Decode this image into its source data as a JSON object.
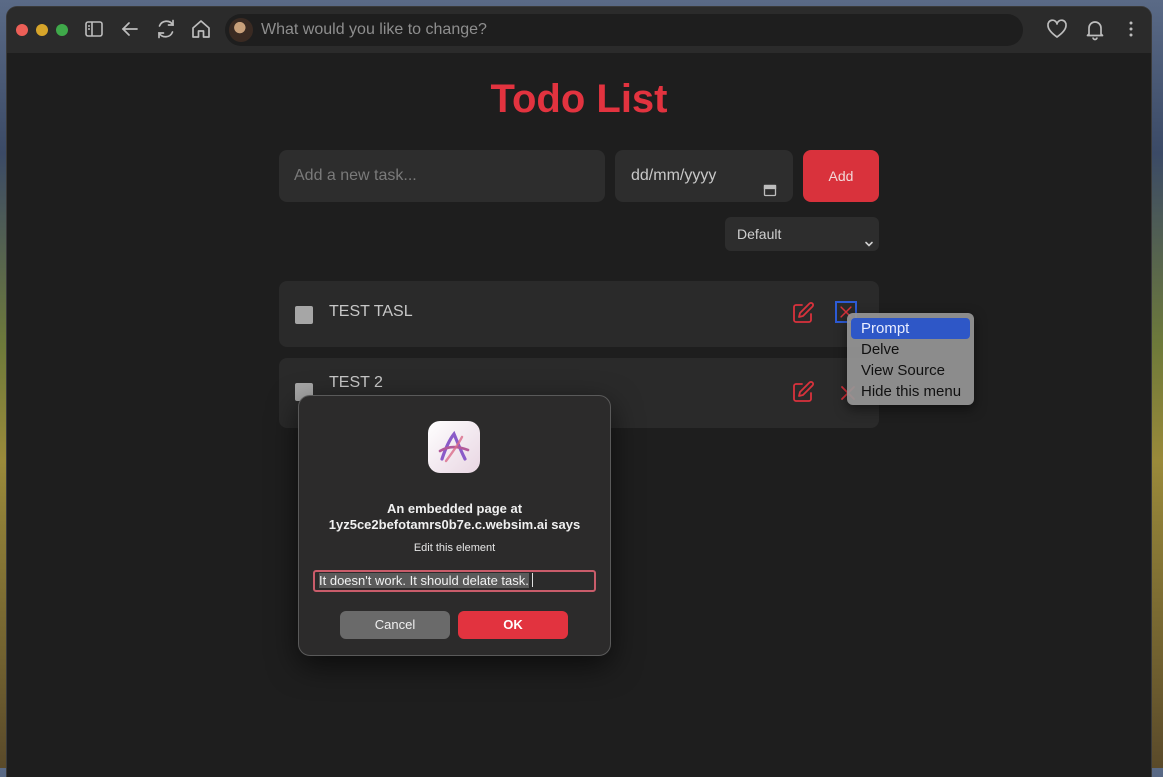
{
  "browser": {
    "address_placeholder": "What would you like to change?",
    "icons": [
      "sidebar-icon",
      "back-arrow-icon",
      "reload-icon",
      "home-icon",
      "heart-icon",
      "bell-icon",
      "more-vertical-icon"
    ]
  },
  "app": {
    "title": "Todo List",
    "title_color": "#e2333f",
    "task_input_placeholder": "Add a new task...",
    "date_input_placeholder": "dd/mm/yyyy",
    "add_button_label": "Add",
    "sort_selected": "Default",
    "tasks": [
      {
        "name": "TEST TASL",
        "completed": false
      },
      {
        "name": "TEST 2",
        "completed": false
      }
    ]
  },
  "context_menu": {
    "items": [
      "Prompt",
      "Delve",
      "View Source",
      "Hide this menu"
    ],
    "selected": "Prompt"
  },
  "dialog": {
    "title_line1": "An embedded page at",
    "title_line2": "1yz5ce2befotamrs0b7e.c.websim.ai says",
    "message": "Edit this element",
    "input_value": "It doesn't work. It should delate task.",
    "cancel_label": "Cancel",
    "ok_label": "OK"
  }
}
